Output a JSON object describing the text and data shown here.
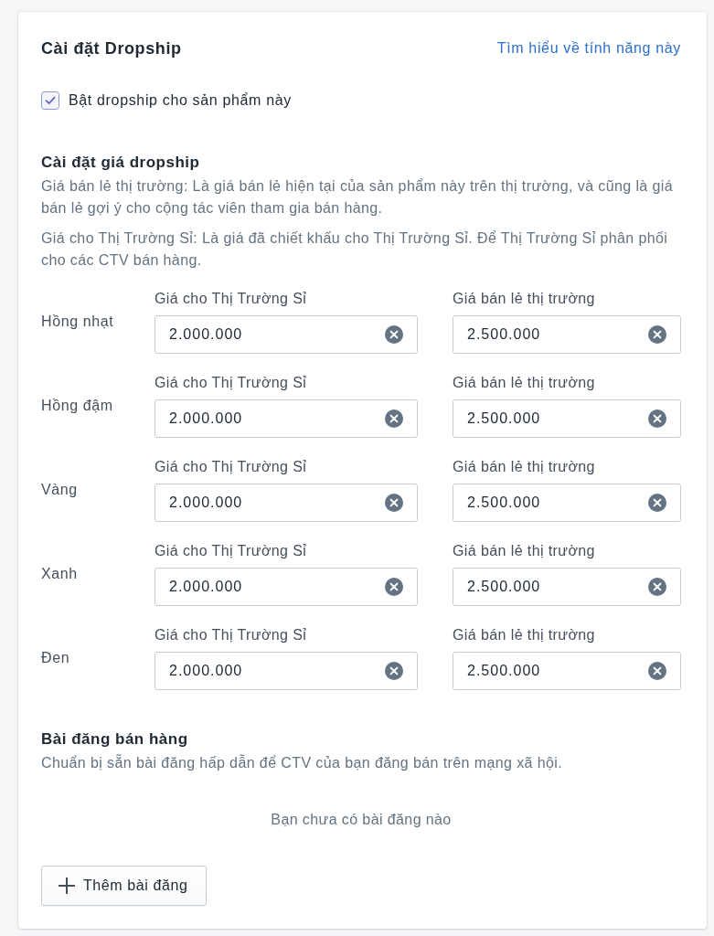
{
  "header": {
    "title": "Cài đặt Dropship",
    "help_link": "Tìm hiểu về tính năng này"
  },
  "enable": {
    "label": "Bật dropship cho sản phẩm này",
    "checked": true
  },
  "pricing": {
    "title": "Cài đặt giá dropship",
    "notes": [
      "Giá bán lẻ thị trường: Là giá bán lẻ hiện tại của sản phẩm này trên thị trường, và cũng là giá bán lẻ gợi ý cho cộng tác viên tham gia bán hàng.",
      "Giá cho Thị Trường Sỉ: Là giá đã chiết khấu cho Thị Trường Sỉ. Để Thị Trường Sỉ phân phối cho các CTV bán hàng."
    ],
    "variants": [
      {
        "name": "Hồng nhạt",
        "fields": [
          {
            "label": "Giá cho Thị Trường Sỉ",
            "value": "2.000.000"
          },
          {
            "label": "Giá bán lẻ thị trường",
            "value": "2.500.000"
          }
        ]
      },
      {
        "name": "Hồng đậm",
        "fields": [
          {
            "label": "Giá cho Thị Trường Sỉ",
            "value": "2.000.000"
          },
          {
            "label": "Giá bán lẻ thị trường",
            "value": "2.500.000"
          }
        ]
      },
      {
        "name": "Vàng",
        "fields": [
          {
            "label": "Giá cho Thị Trường Sỉ",
            "value": "2.000.000"
          },
          {
            "label": "Giá bán lẻ thị trường",
            "value": "2.500.000"
          }
        ]
      },
      {
        "name": "Xanh",
        "fields": [
          {
            "label": "Giá cho Thị Trường Sỉ",
            "value": "2.000.000"
          },
          {
            "label": "Giá bán lẻ thị trường",
            "value": "2.500.000"
          }
        ]
      },
      {
        "name": "Đen",
        "fields": [
          {
            "label": "Giá cho Thị Trường Sỉ",
            "value": "2.000.000"
          },
          {
            "label": "Giá bán lẻ thị trường",
            "value": "2.500.000"
          }
        ]
      }
    ]
  },
  "posts": {
    "title": "Bài đăng bán hàng",
    "description": "Chuẩn bị sẵn bài đăng hấp dẫn để CTV của bạn đăng bán trên mạng xã hội.",
    "empty_text": "Bạn chưa có bài đăng nào",
    "add_button": "Thêm bài đăng"
  }
}
